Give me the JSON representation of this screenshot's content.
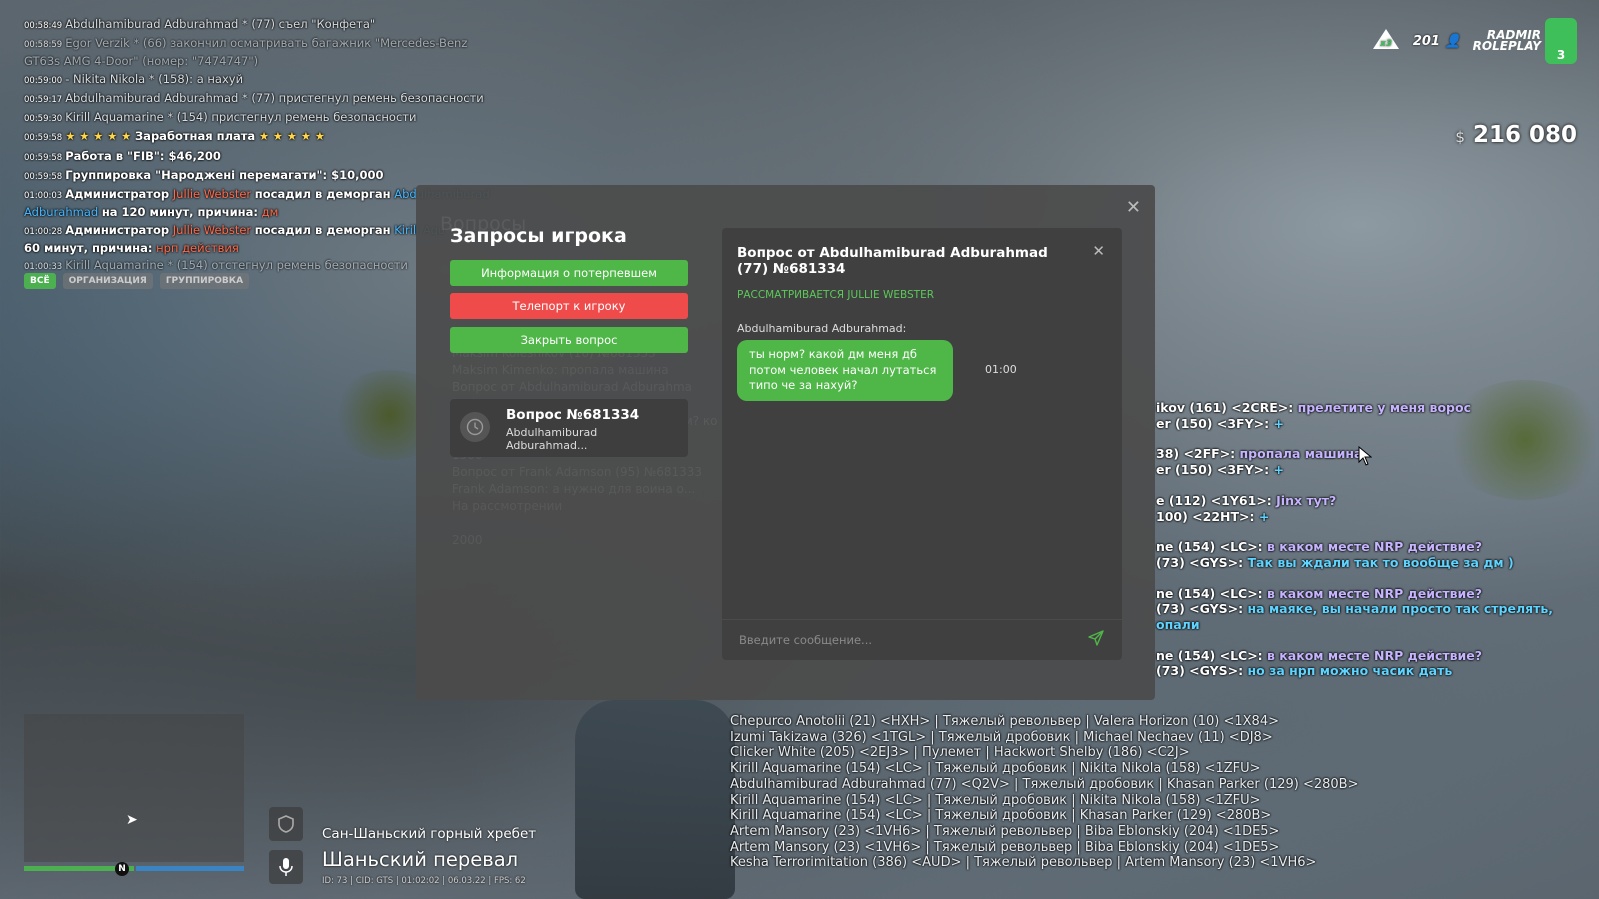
{
  "chat": {
    "lines": [
      {
        "ts": "00:58:49",
        "text": "Abdulhamiburad Adburahmad * (77) съел \"Конфета\""
      },
      {
        "ts": "00:58:59",
        "text": "Egor Verzik * (66) закончил осматривать багажник \"Mercedes-Benz"
      },
      {
        "ts": "",
        "text": "GT63s AMG 4-Door\" (номер: \"7474747\")"
      },
      {
        "ts": "00:59:00",
        "text": "- Nikita Nikola * (158): а нахуй"
      },
      {
        "ts": "00:59:17",
        "text": "Abdulhamiburad Adburahmad * (77) пристегнул ремень безопасности"
      },
      {
        "ts": "00:59:30",
        "text": "Kirill Aquamarine * (154) пристегнул ремень безопасности"
      }
    ],
    "salary": {
      "ts": "00:59:58",
      "stars_left": "★ ★ ★ ★ ★",
      "label": "Заработная плата",
      "stars_right": "★ ★ ★ ★ ★"
    },
    "job": {
      "ts": "00:59:58",
      "text": "Работа в \"FIB\": $46,200"
    },
    "group": {
      "ts": "00:59:58",
      "text": "Группировка \"Народжені перемагати\": $10,000"
    },
    "admin1": {
      "ts": "01:00:03",
      "prefix": "Администратор",
      "admin": "Jullie Webster",
      "action": "посадил в деморган",
      "target": "Abdulhamiburad",
      "target2": "Adburahmad",
      "rest": "на 120 минут, причина:",
      "reason": "дм"
    },
    "admin2": {
      "ts": "01:00:28",
      "prefix": "Администратор",
      "admin": "Jullie Webster",
      "action": "посадил в деморган",
      "target": "Kirill Aqu",
      "rest": "60 минут, причина:",
      "reason": "нрп действия"
    },
    "last": {
      "ts": "01:00:33",
      "text": "Kirill Aquamarine * (154) отстегнул ремень безопасности"
    },
    "tabs": [
      "ВСЁ",
      "ОРГАНИЗАЦИЯ",
      "ГРУППИРОВКА"
    ]
  },
  "hud": {
    "x_badge": "x3",
    "online": "201",
    "logo_line1": "RADMIR",
    "logo_line2": "ROLEPLAY",
    "server": "3",
    "currency": "$",
    "money": "216 080",
    "colors": {
      "brand": "#3fbf5a"
    }
  },
  "modal": {
    "ghost_title": "Вопросы",
    "title": "Запросы игрока",
    "btn_info": "Информация о потерпевшем",
    "btn_teleport": "Телепорт к игроку",
    "btn_close": "Закрыть вопрос",
    "card": {
      "title": "Вопрос №681334",
      "author_line1": "Abdulhamiburad",
      "author_line2": "Adburahmad..."
    },
    "ghost_list": [
      "Maksim Kolesnikov (16) №681333",
      "Maksim Kimenko: пропала машина",
      "Вопрос от Abdulhamiburad Adburahma",
      "(77) №681334",
      "Abdulhamiburad Adburahmad: ты норм? ко",
      "",
      "1500",
      "Вопрос от Frank Adamson (95) №681333",
      "Frank Adamson: а нужно для воина о...",
      "На рассмотрении",
      "",
      "2000"
    ],
    "panel": {
      "title": "Вопрос от Abdulhamiburad Adburahmad (77) №681334",
      "status": "РАССМАТРИВАЕТСЯ JULLIE WEBSTER",
      "author": "Abdulhamiburad Adburahmad:",
      "message": "ты норм? какой дм меня дб потом человек начал лутаться типо че за нахуй?",
      "time": "01:00",
      "input_placeholder": "Введите сообщение..."
    },
    "colors": {
      "green": "#4fb648",
      "red": "#f04b4b"
    }
  },
  "rchat": [
    {
      "who": "ikov (161) <2CRE>:",
      "msg": "прелетите у меня ворос"
    },
    {
      "who": "er (150) <3FY>:",
      "ans": "+"
    },
    {
      "gap": true
    },
    {
      "who": "38) <2FF>:",
      "msg": "пропала машина"
    },
    {
      "who": "er (150) <3FY>:",
      "ans": "+"
    },
    {
      "gap": true
    },
    {
      "who": "e (112) <1Y61>:",
      "msg": "Jinx тут?"
    },
    {
      "who": "100) <22HT>:",
      "ans": "+"
    },
    {
      "gap": true
    },
    {
      "who": "ne (154) <LC>:",
      "msg": "в каком месте NRP действие?"
    },
    {
      "who": "(73) <GYS>:",
      "ans": "Так вы ждали так то вообще за дм )"
    },
    {
      "gap": true
    },
    {
      "who": "ne (154) <LC>:",
      "msg": "в каком месте NRP действие?"
    },
    {
      "who": "(73) <GYS>:",
      "ans": "на маяке, вы начали просто так стрелять,"
    },
    {
      "who": "",
      "ans": "опали"
    },
    {
      "gap": true
    },
    {
      "who": "ne (154) <LC>:",
      "msg": "в каком месте NRP действие?"
    },
    {
      "who": "(73) <GYS>:",
      "ans": "но за нрп можно часик дать"
    }
  ],
  "killfeed": [
    "Chepurco Anotolii (21) <HXH> | Тяжелый револьвер | Valera Horizon (10) <1X84>",
    "Izumi Takizawa (326) <1TGL> | Тяжелый дробовик | Michael Nechaev (11) <DJ8>",
    "Clicker White (205) <2EJ3> | Пулемет | Hackwort Shelby (186) <C2J>",
    "Kirill Aquamarine (154) <LC> | Тяжелый дробовик | Nikita Nikola (158) <1ZFU>",
    "Abdulhamiburad Adburahmad (77) <Q2V> | Тяжелый дробовик | Khasan Parker (129) <280B>",
    "Kirill Aquamarine (154) <LC> | Тяжелый дробовик | Nikita Nikola (158) <1ZFU>",
    "Kirill Aquamarine (154) <LC> | Тяжелый дробовик | Khasan Parker (129) <280B>",
    "Artem Mansory (23) <1VH6> | Тяжелый револьвер | Biba Eblonskiy (204) <1DE5>",
    "Artem Mansory (23) <1VH6> | Тяжелый револьвер | Biba Eblonskiy (204) <1DE5>",
    "Kesha Terrorimitation (386) <AUD> | Тяжелый револьвер | Artem Mansory (23) <1VH6>"
  ],
  "location": {
    "compass": "N",
    "area": "Сан-Шаньский горный хребет",
    "street": "Шаньский перевал",
    "info": "ID: 73 | CID: GTS | 01:02:02  |  06.03.22 | FPS: 62"
  }
}
